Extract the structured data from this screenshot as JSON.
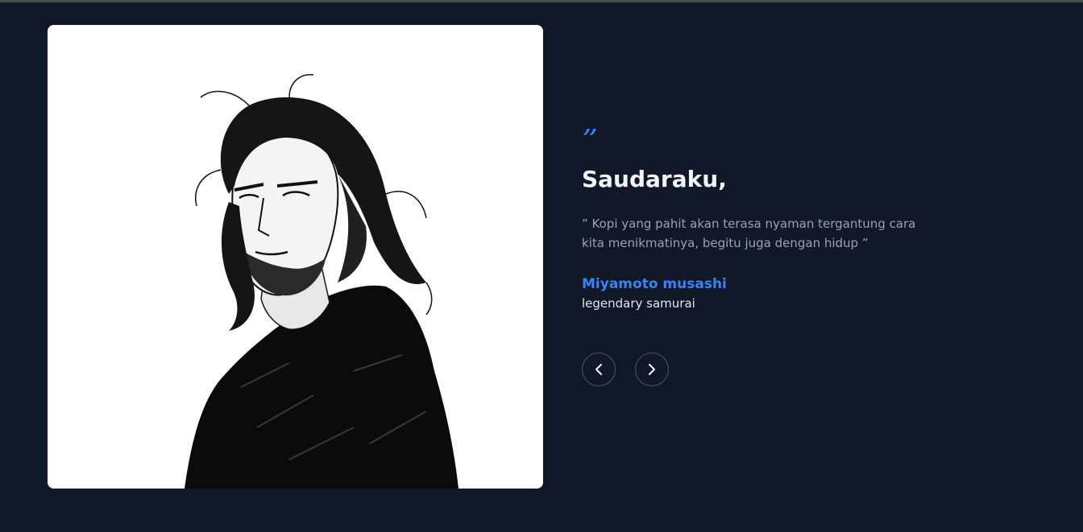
{
  "testimonial": {
    "quote_mark": "”",
    "greeting": "Saudaraku,",
    "quote": "” Kopi yang pahit akan terasa nyaman tergantung cara kita menikmatinya, begitu juga dengan hidup ”",
    "author_name": "Miyamoto musashi",
    "author_role": "legendary samurai"
  },
  "navigation": {
    "prev_icon": "chevron-left-icon",
    "next_icon": "chevron-right-icon"
  },
  "colors": {
    "background": "#111827",
    "accent": "#3b82f6",
    "heading": "#f3f4f6",
    "body_text": "#9ca3af"
  }
}
